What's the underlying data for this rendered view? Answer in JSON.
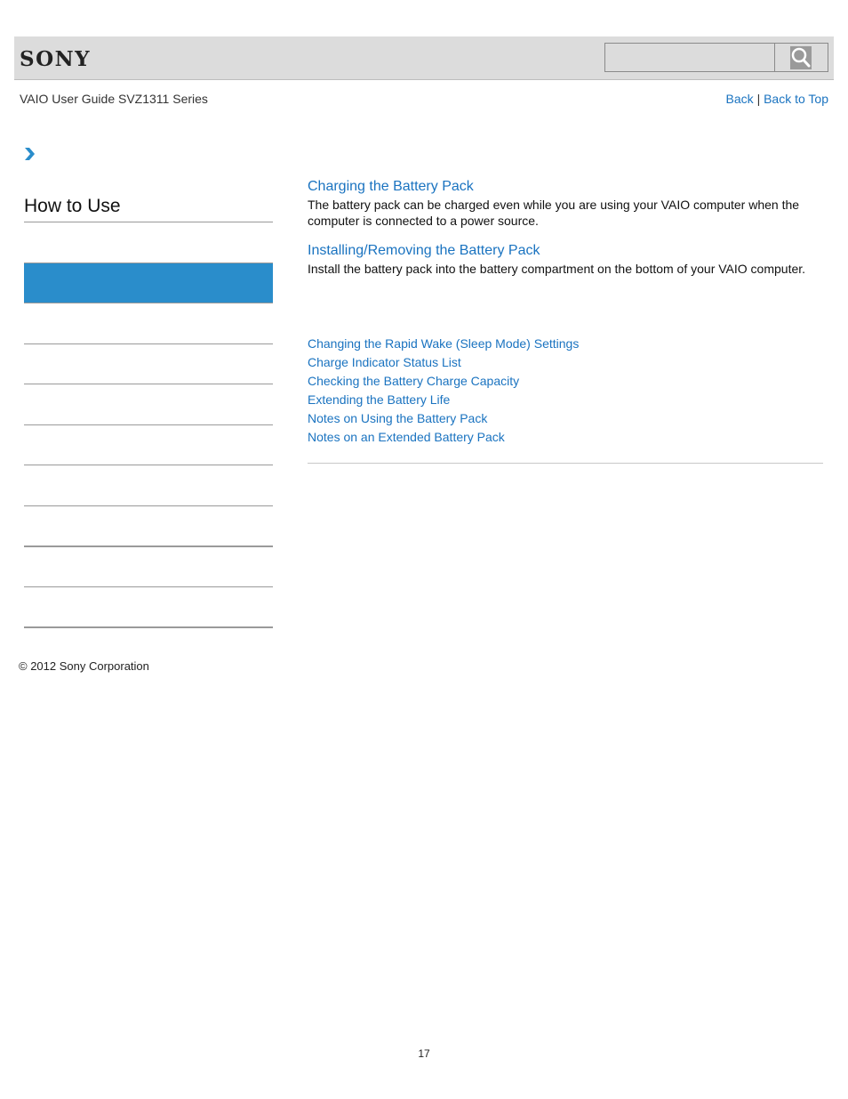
{
  "header": {
    "logo": "SONY",
    "search": {
      "value": "",
      "placeholder": ""
    },
    "search_icon": "magnifier-icon"
  },
  "guide_title": "VAIO User Guide SVZ1311 Series",
  "topnav": {
    "back": "Back",
    "separator": "|",
    "back_to_top": "Back to Top"
  },
  "breadcrumb": {
    "icon": "chevron-right-icon",
    "accent": "#2a8dcb"
  },
  "sidebar": {
    "title": "How to Use",
    "active_color": "#2a8dcb",
    "item_count": 8
  },
  "main": {
    "sections": [
      {
        "title": "Charging the Battery Pack",
        "description": "The battery pack can be charged even while you are using your VAIO computer when the computer is connected to a power source."
      },
      {
        "title": "Installing/Removing the Battery Pack",
        "description": "Install the battery pack into the battery compartment on the bottom of your VAIO computer."
      }
    ],
    "related_links": [
      "Changing the Rapid Wake (Sleep Mode) Settings",
      "Charge Indicator Status List",
      "Checking the Battery Charge Capacity",
      "Extending the Battery Life",
      "Notes on Using the Battery Pack",
      "Notes on an Extended Battery Pack"
    ]
  },
  "footer": {
    "copyright": "© 2012 Sony Corporation",
    "page_number": "17"
  },
  "colors": {
    "link": "#1a73c0",
    "header_bg": "#dcdcdc"
  }
}
